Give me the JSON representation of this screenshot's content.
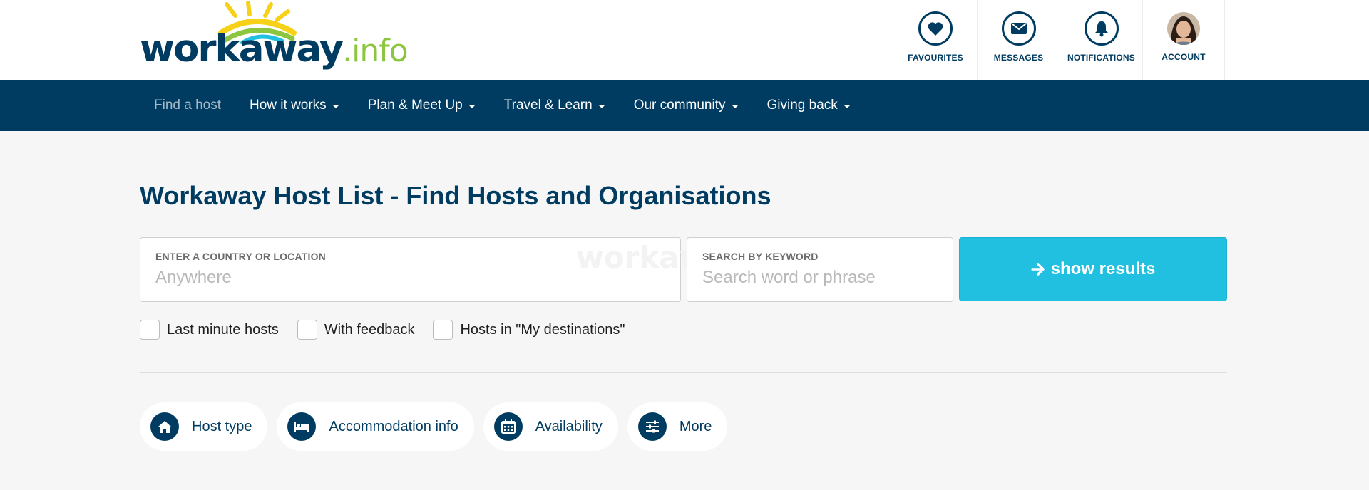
{
  "brand": {
    "logo_main": "workaway",
    "logo_suffix": ".info"
  },
  "top_nav": {
    "favourites": "FAVOURITES",
    "messages": "MESSAGES",
    "notifications": "NOTIFICATIONS",
    "account": "ACCOUNT"
  },
  "main_nav": {
    "find_host": "Find a host",
    "how_it_works": "How it works",
    "plan_meet": "Plan & Meet Up",
    "travel_learn": "Travel & Learn",
    "community": "Our community",
    "giving_back": "Giving back"
  },
  "page": {
    "title": "Workaway Host List - Find Hosts and Organisations"
  },
  "search": {
    "location_label": "ENTER A COUNTRY OR LOCATION",
    "location_placeholder": "Anywhere",
    "keyword_label": "SEARCH BY KEYWORD",
    "keyword_placeholder": "Search word or phrase",
    "watermark": "workaway",
    "submit_label": "show results"
  },
  "checkboxes": {
    "last_minute": "Last minute hosts",
    "feedback": "With feedback",
    "destinations": "Hosts in \"My destinations\""
  },
  "filters": {
    "host_type": "Host type",
    "accommodation": "Accommodation info",
    "availability": "Availability",
    "more": "More"
  },
  "colors": {
    "primary": "#003c61",
    "accent": "#21c0e0",
    "logo_green": "#8cc63f",
    "sun_yellow": "#f7d117"
  }
}
